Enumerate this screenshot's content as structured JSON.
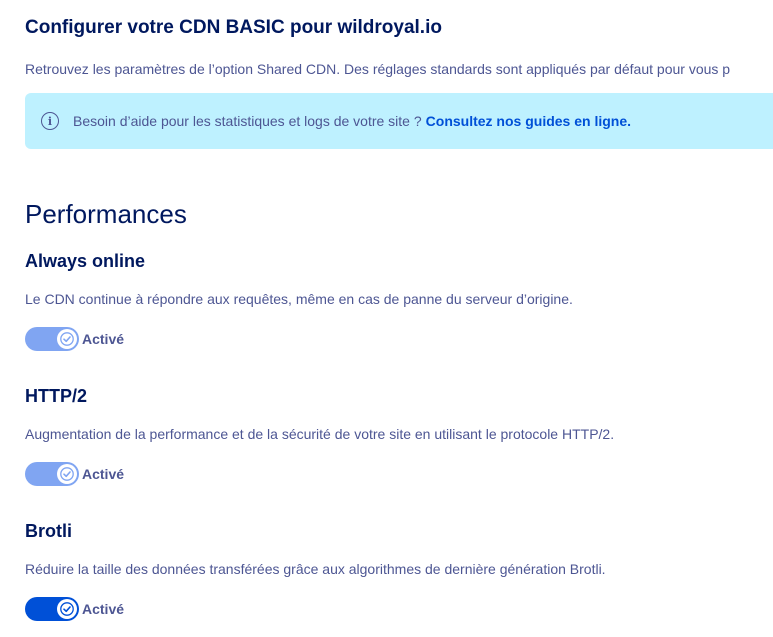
{
  "header": {
    "title": "Configurer votre CDN BASIC pour wildroyal.io",
    "intro": "Retrouvez les paramètres de l’option Shared CDN. Des réglages standards sont appliqués par défaut pour vous p"
  },
  "info_banner": {
    "icon": "info-icon",
    "text": "Besoin d’aide pour les statistiques et logs de votre site ?",
    "link_label": "Consultez nos guides en ligne."
  },
  "section": {
    "title": "Performances"
  },
  "features": [
    {
      "title": "Always online",
      "description": "Le CDN continue à répondre aux requêtes, même en cas de panne du serveur d’origine.",
      "toggle_label": "Activé",
      "enabled": true
    },
    {
      "title": "HTTP/2",
      "description": "Augmentation de la performance et de la sécurité de votre site en utilisant le protocole HTTP/2.",
      "toggle_label": "Activé",
      "enabled": true
    },
    {
      "title": "Brotli",
      "description": "Réduire la taille des données transférées grâce aux algorithmes de dernière génération Brotli.",
      "toggle_label": "Activé",
      "enabled": true
    }
  ],
  "colors": {
    "title": "#00185e",
    "text": "#4d5693",
    "link": "#0050d7",
    "banner_bg": "#bef1ff",
    "toggle_soft": "#80a5f2",
    "toggle_strong": "#0050d7"
  }
}
